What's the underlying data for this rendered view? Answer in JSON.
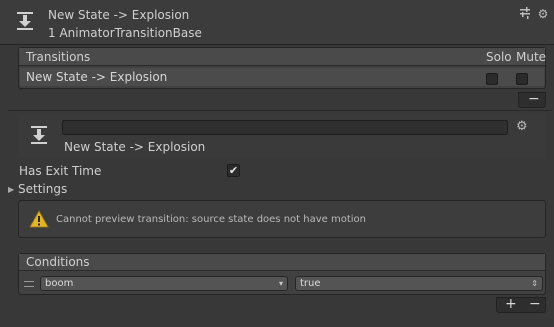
{
  "header": {
    "title": "New State -> Explosion",
    "subtitle": "1 AnimatorTransitionBase",
    "icon": "transition-icon"
  },
  "transitions": {
    "label": "Transitions",
    "solo_label": "Solo",
    "mute_label": "Mute",
    "rows": [
      {
        "name": "New State -> Explosion",
        "solo": false,
        "mute": false
      }
    ]
  },
  "detail": {
    "name_value": "",
    "label": "New State -> Explosion"
  },
  "has_exit_time": {
    "label": "Has Exit Time",
    "checked": true
  },
  "settings": {
    "label": "Settings",
    "expanded": false
  },
  "warning": {
    "message": "Cannot preview transition: source state does not have motion",
    "icon": "warning-icon",
    "color": "#e2b52a"
  },
  "conditions": {
    "label": "Conditions",
    "rows": [
      {
        "parameter": "boom",
        "value": "true"
      }
    ]
  },
  "colors": {
    "background": "#383838",
    "panel_header": "#4a4a4a",
    "text": "#cfcfcf"
  }
}
